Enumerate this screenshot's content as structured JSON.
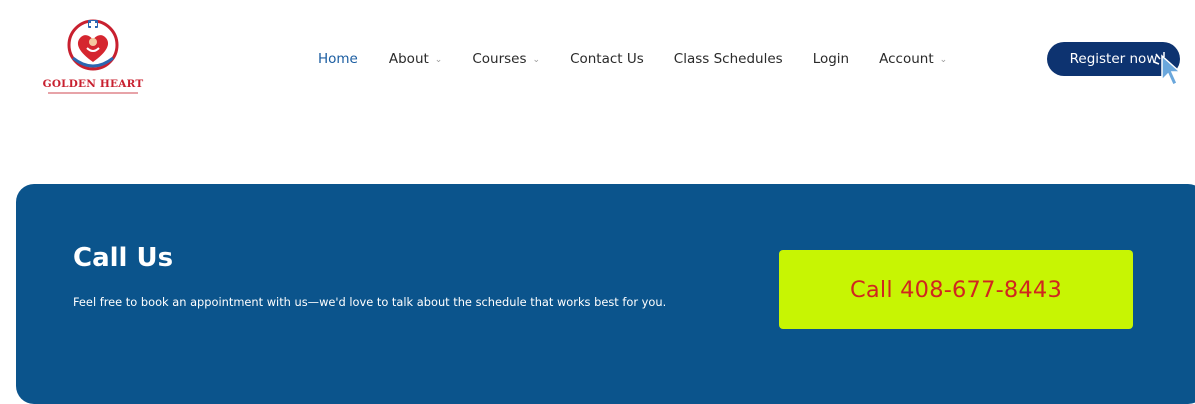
{
  "brand": {
    "name": "GOLDEN HEART"
  },
  "nav": {
    "home": "Home",
    "about": "About",
    "courses": "Courses",
    "contact": "Contact Us",
    "schedules": "Class Schedules",
    "login": "Login",
    "account": "Account",
    "caret_glyph": "⌄"
  },
  "register": {
    "label": "Register now"
  },
  "cta": {
    "title": "Call Us",
    "text": "Feel free to book an appointment with us—we'd love to talk about the schedule that works best for you.",
    "button": "Call 408-677-8443"
  },
  "colors": {
    "nav_active": "#1b5da1",
    "register_bg": "#0d3370",
    "cta_bg": "#0b548c",
    "call_button_bg": "#c7f503",
    "call_button_text": "#d0261f",
    "logo_red": "#c8202f"
  },
  "icons": {
    "logo": "heart-nurse-logo-icon",
    "dropdown": "chevron-down-icon",
    "cursor": "mouse-pointer-icon"
  }
}
